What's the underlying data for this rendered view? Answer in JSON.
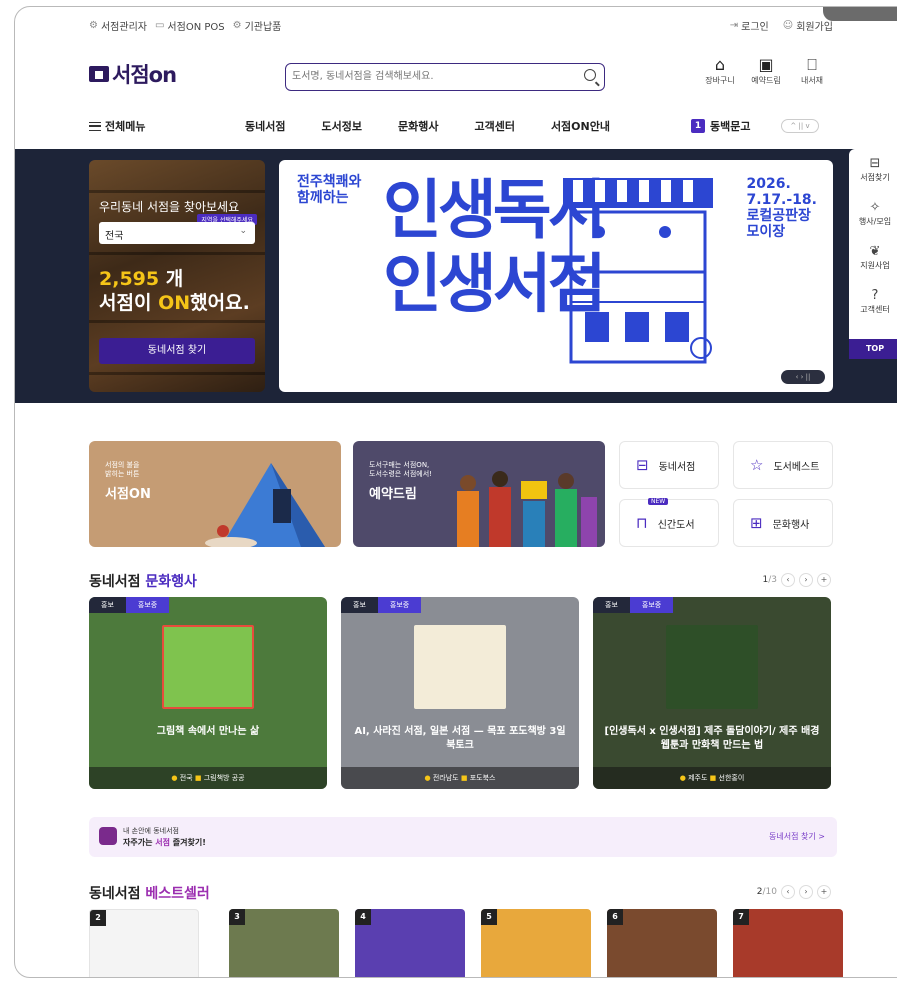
{
  "utility": {
    "links": [
      {
        "label": "서점관리자",
        "icon": "user-gear-icon"
      },
      {
        "label": "서점ON POS",
        "icon": "monitor-icon"
      },
      {
        "label": "기관납품",
        "icon": "settings-icon"
      }
    ],
    "login": "로그인",
    "signup": "회원가입"
  },
  "header": {
    "logo_text": "서점on",
    "search_placeholder": "도서명, 동네서점을 검색해보세요.",
    "icons": [
      {
        "label": "장바구니",
        "icon": "cart-icon"
      },
      {
        "label": "예약드림",
        "icon": "reserve-icon"
      },
      {
        "label": "내서재",
        "icon": "bookmark-icon"
      }
    ]
  },
  "gnb": {
    "all_menu": "전체메뉴",
    "items": [
      "동네서점",
      "도서정보",
      "문화행사",
      "고객센터",
      "서점ON안내"
    ],
    "promo_num": "1",
    "promo_text": "동백문고"
  },
  "hero": {
    "finder": {
      "heading": "우리동네 서점을 찾아보세요",
      "tip": "지역을 선택해주세요",
      "region": "전국",
      "count": "2,595",
      "count_unit": " 개",
      "line2_pre": "서점이 ",
      "line2_on": "ON",
      "line2_post": "했어요.",
      "button": "동네서점 찾기"
    },
    "banner": {
      "left": "전주책쾌와\n함께하는",
      "big1": "인생독서",
      "big2": "인생서점",
      "right_date": "2026.\n7.17.-18.",
      "right_place": "로컬공판장\n모이장"
    }
  },
  "quickmenu": [
    {
      "label": "서점찾기",
      "icon": "store-icon"
    },
    {
      "label": "행사/모임",
      "icon": "sparkle-icon"
    },
    {
      "label": "지원사업",
      "icon": "sprout-icon"
    },
    {
      "label": "고객센터",
      "icon": "question-icon"
    }
  ],
  "quick_top": "TOP",
  "services": {
    "card1": {
      "small": "서점의 불을\n밝히는 버튼",
      "title": "서점ON"
    },
    "card2": {
      "small": "도서구매는 서점ON,\n도서수령은 서점에서!",
      "title": "예약드림"
    },
    "tiles": [
      {
        "label": "동네서점",
        "icon": "store-icon"
      },
      {
        "label": "도서베스트",
        "icon": "star-icon"
      },
      {
        "label": "신간도서",
        "icon": "book-open-icon",
        "badge": "NEW"
      },
      {
        "label": "문화행사",
        "icon": "grid-icon"
      }
    ]
  },
  "events": {
    "heading_pre": "동네서점 ",
    "heading_acc": "문화행사",
    "page": "1",
    "total": "/3",
    "items": [
      {
        "tag1": "홍보",
        "tag2": "홍보중",
        "title": "그림책 속에서 만나는 삶",
        "region": "전국",
        "store": "그림책방 공공"
      },
      {
        "tag1": "홍보",
        "tag2": "홍보중",
        "title": "AI, 사라진 서점, 일본 서점 — 목포 포도책방 3일 북토크",
        "region": "전라남도",
        "store": "포도북스"
      },
      {
        "tag1": "홍보",
        "tag2": "홍보중",
        "title": "[인생독서 x 인생서점] 제주 돌담이야기/ 제주 배경 웹툰과 만화책 만드는 법",
        "region": "제주도",
        "store": "선한홍이"
      }
    ]
  },
  "band": {
    "line1": "내 손안에 동네서점",
    "line2_pre": "자주가는 ",
    "line2_acc": "서점",
    "line2_post": " 즐겨찾기!",
    "link": "동네서점 찾기 >"
  },
  "best": {
    "heading_pre": "동네서점 ",
    "heading_acc": "베스트셀러",
    "page": "2",
    "total": "/10",
    "ranks": [
      "2",
      "3",
      "4",
      "5",
      "6",
      "7"
    ]
  },
  "colors": {
    "brand": "#2d1a5e",
    "accent": "#4b2cc0",
    "hero_bg": "#1d2438",
    "banner_blue": "#2c46d2",
    "highlight": "#f5c518"
  }
}
